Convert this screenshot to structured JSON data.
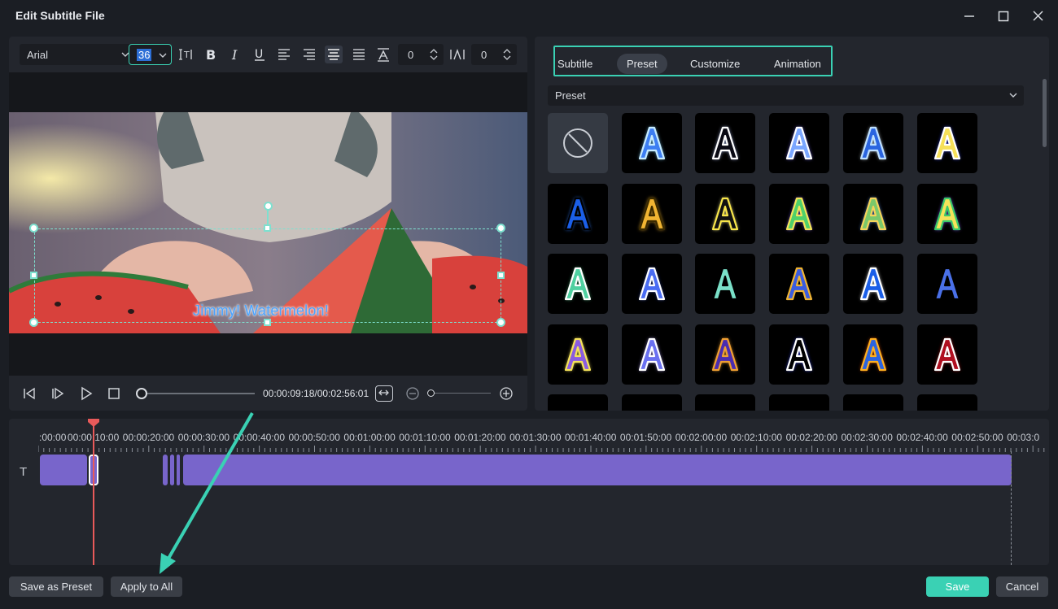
{
  "window": {
    "title": "Edit Subtitle File"
  },
  "toolbar": {
    "font": "Arial",
    "font_size": "36",
    "letter_spacing": "0",
    "line_spacing": "0"
  },
  "preview": {
    "subtitle_text": "Jimmy! Watermelon!"
  },
  "playback": {
    "timecode": "00:00:09:18/00:02:56:01",
    "progress": 0.03
  },
  "right_panel": {
    "tabs": [
      {
        "label": "Subtitle"
      },
      {
        "label": "Preset"
      },
      {
        "label": "Customize"
      },
      {
        "label": "Animation"
      }
    ],
    "active_tab": "Preset",
    "dropdown_value": "Preset",
    "preset_count": 24,
    "accent_color": "#3ad1b4"
  },
  "timeline": {
    "ruler_labels": [
      ":00:00",
      "00:00:10:00",
      "00:00:20:00",
      "00:00:30:00",
      "00:00:40:00",
      "00:00:50:00",
      "00:01:00:00",
      "00:01:10:00",
      "00:01:20:00",
      "00:01:30:00",
      "00:01:40:00",
      "00:01:50:00",
      "00:02:00:00",
      "00:02:10:00",
      "00:02:20:00",
      "00:02:30:00",
      "00:02:40:00",
      "00:02:50:00",
      "00:03:0"
    ],
    "clip_color": "#7865cb",
    "playhead_color": "#e85a5a"
  },
  "buttons": {
    "save_as_preset": "Save as Preset",
    "apply_to_all": "Apply to All",
    "save": "Save",
    "cancel": "Cancel"
  },
  "icons": {
    "min": "minimize-icon",
    "max": "maximize-icon",
    "close": "close-icon"
  }
}
